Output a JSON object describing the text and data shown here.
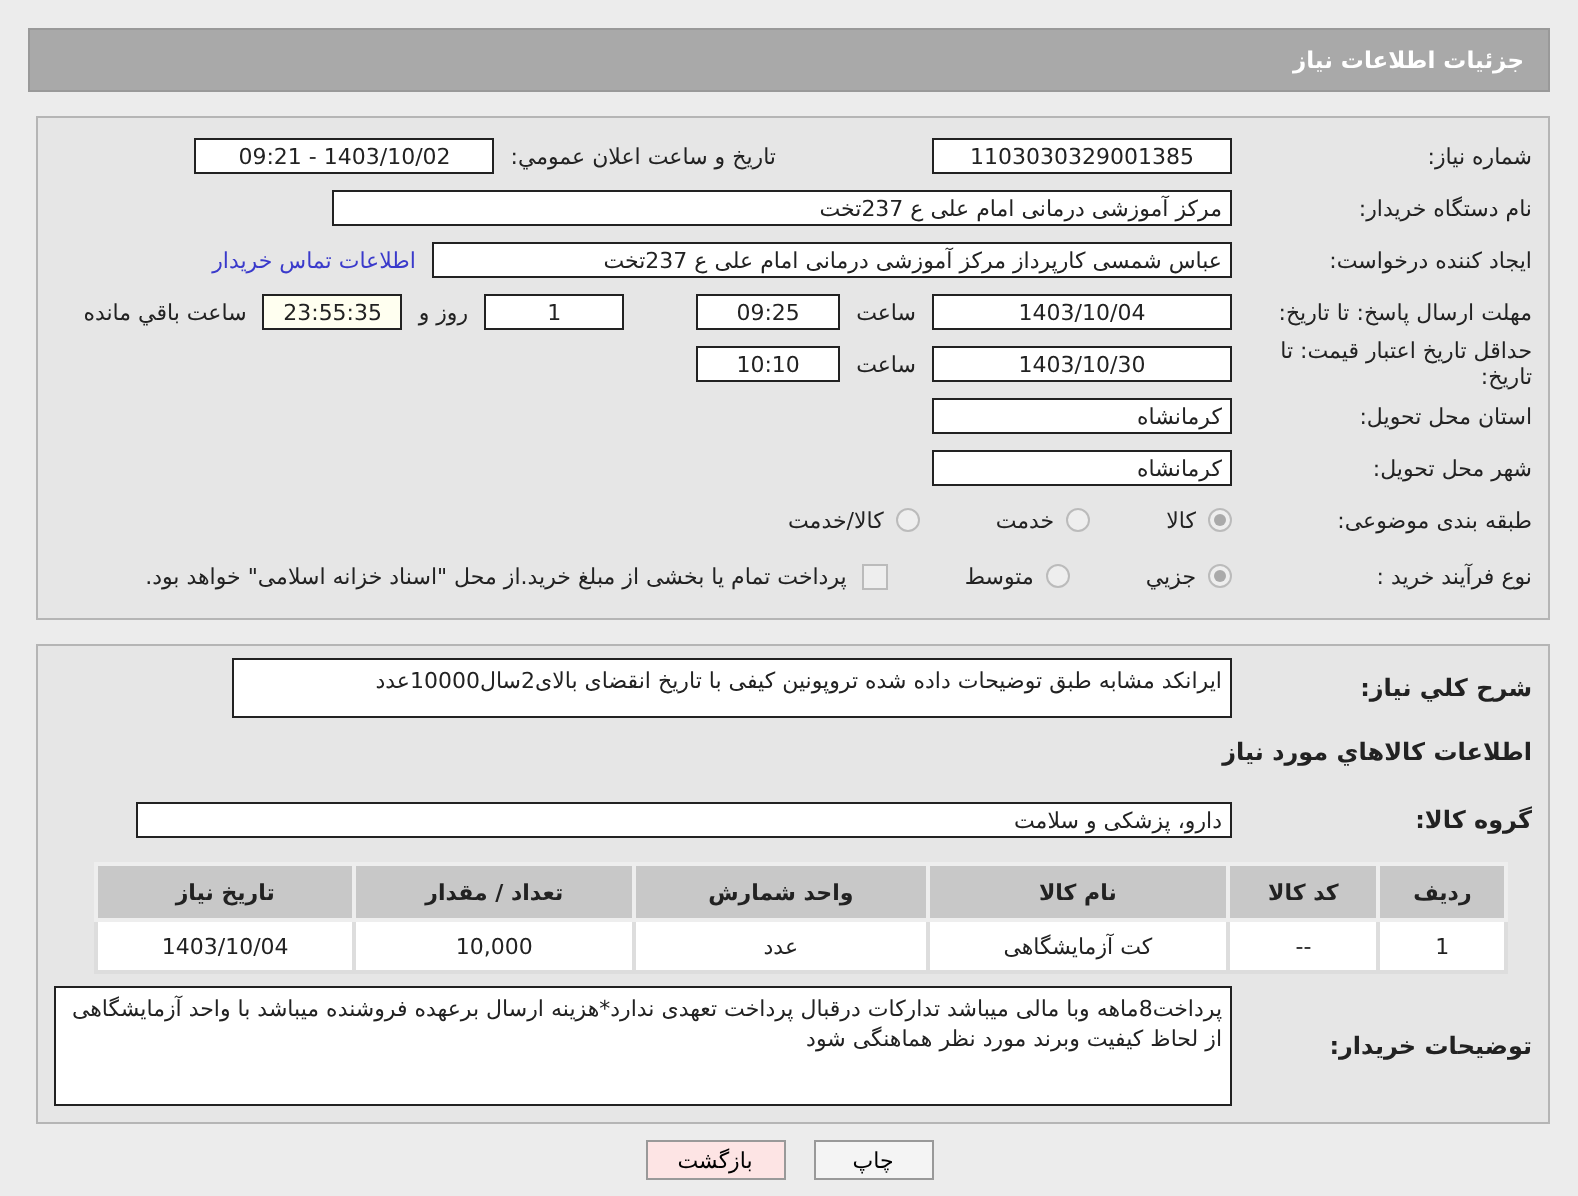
{
  "header": {
    "title": "جزئیات اطلاعات نیاز"
  },
  "need_number": {
    "label": "شماره نیاز:",
    "value": "1103030329001385"
  },
  "announce": {
    "label": "تاریخ و ساعت اعلان عمومي:",
    "value": "1403/10/02 - 09:21"
  },
  "buyer_org": {
    "label": "نام دستگاه خریدار:",
    "value": "مرکز آموزشی درمانی امام علی ع 237تخت"
  },
  "creator": {
    "label": "ایجاد کننده درخواست:",
    "value": "عباس شمسی کارپرداز  مرکز آموزشی درمانی امام علی ع 237تخت",
    "link": "اطلاعات تماس خریدار"
  },
  "deadline": {
    "label": "مهلت ارسال پاسخ: تا تاریخ:",
    "date": "1403/10/04",
    "time_label": "ساعت",
    "time": "09:25",
    "days": "1",
    "days_label": "روز و",
    "remaining": "23:55:35",
    "remaining_label": "ساعت باقي مانده"
  },
  "price_validity": {
    "label": "حداقل تاریخ اعتبار قیمت: تا تاریخ:",
    "date": "1403/10/30",
    "time_label": "ساعت",
    "time": "10:10"
  },
  "province": {
    "label": "استان محل تحویل:",
    "value": "کرمانشاه"
  },
  "city": {
    "label": "شهر محل تحویل:",
    "value": "کرمانشاه"
  },
  "category": {
    "label": "طبقه بندی موضوعی:",
    "options": [
      {
        "label": "کالا",
        "selected": true
      },
      {
        "label": "خدمت",
        "selected": false
      },
      {
        "label": "کالا/خدمت",
        "selected": false
      }
    ]
  },
  "process": {
    "label": "نوع فرآیند خرید :",
    "options": [
      {
        "label": "جزيي",
        "selected": true
      },
      {
        "label": "متوسط",
        "selected": false
      }
    ],
    "treasury": {
      "label": "پرداخت تمام یا بخشی از مبلغ خرید.از محل \"اسناد خزانه اسلامی\" خواهد بود.",
      "checked": false
    }
  },
  "description": {
    "label": "شرح کلي نیاز:",
    "value": "ایرانکد مشابه  طبق توضیحات داده شده تروپونین کیفی با تاریخ انقضای بالای2سال10000عدد"
  },
  "goods_heading": "اطلاعات کالاهاي مورد نیاز",
  "goods_group": {
    "label": "گروه کالا:",
    "value": "دارو، پزشکی و سلامت"
  },
  "table": {
    "columns": [
      "ردیف",
      "کد کالا",
      "نام کالا",
      "واحد شمارش",
      "تعداد / مقدار",
      "تاریخ نیاز"
    ],
    "rows": [
      [
        "1",
        "--",
        "کت آزمایشگاهی",
        "عدد",
        "10,000",
        "1403/10/04"
      ]
    ]
  },
  "buyer_notes": {
    "label": "توضیحات خریدار:",
    "value": "پرداخت8ماهه وبا مالی میباشد تدارکات درقبال پرداخت تعهدی ندارد*هزینه ارسال برعهده فروشنده میباشد با واحد آزمایشگاهی از لحاظ کیفیت وبرند مورد نظر هماهنگی شود"
  },
  "buttons": [
    {
      "label": "چاپ",
      "kind": "print"
    },
    {
      "label": "بازگشت",
      "kind": "back"
    }
  ]
}
